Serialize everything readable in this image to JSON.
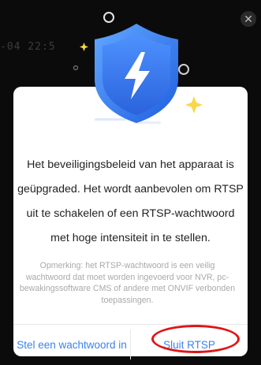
{
  "background": {
    "timestamp_text": "-04 22:5"
  },
  "dialog": {
    "close_icon": "close-icon",
    "hero_icon": "shield-lightning-icon",
    "message": "Het beveiligingsbeleid van het apparaat is geüpgraded. Het wordt aanbevolen om RTSP uit te schakelen of een RTSP-wachtwoord met hoge intensiteit in te stellen.",
    "message_lines": [
      "Het beveiligingsbeleid van het apparaat is",
      "geüpgraded. Het wordt aanbevolen om RTSP",
      "uit te schakelen of een RTSP-wachtwoord",
      "met hoge intensiteit in te stellen."
    ],
    "note": "Opmerking: het RTSP-wachtwoord is een veilig wachtwoord dat moet worden ingevoerd voor NVR, pc-bewakingssoftware CMS of andere met ONVIF verbonden toepassingen.",
    "buttons": {
      "set_password": "Stel een wachtwoord in",
      "close_rtsp": "Sluit RTSP"
    }
  },
  "colors": {
    "accent_blue": "#3b82f0",
    "shield_blue": "#2f6fe6",
    "highlight_red": "#e01616",
    "text_dark": "#222222",
    "text_muted": "#a9a9a9"
  }
}
